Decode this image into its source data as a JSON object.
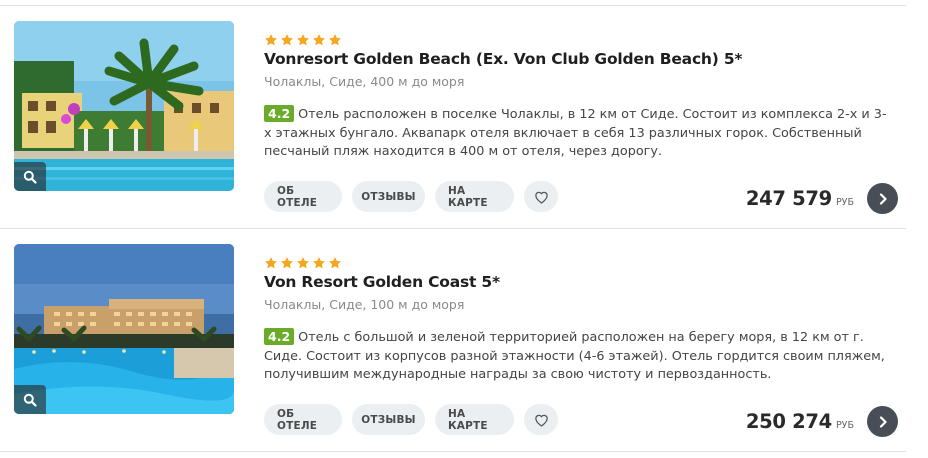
{
  "hotels": [
    {
      "stars": 5,
      "name": "Vonresort Golden Beach (Ex. Von Club Golden Beach) 5*",
      "location": "Чолаклы, Сиде, 400 м до моря",
      "rating": "4.2",
      "description": "Отель расположен в поселке Чолаклы, в 12 км от Сиде. Состоит из комплекса 2-х и 3-х этажных бунгало. Аквапарк отеля включает в себя 13 различных горок. Собственный песчаный пляж находится в 400 м от отеля, через дорогу.",
      "buttons": {
        "about": "ОБ ОТЕЛЕ",
        "reviews": "ОТЗЫВЫ",
        "map": "НА КАРТЕ"
      },
      "price": "247 579",
      "currency": "РУБ"
    },
    {
      "stars": 5,
      "name": "Von Resort Golden Coast 5*",
      "location": "Чолаклы, Сиде, 100 м до моря",
      "rating": "4.2",
      "description": "Отель с большой и зеленой территорией расположен на берегу моря, в 12 км от г. Сиде. Состоит из корпусов разной этажности (4-6 этажей). Отель гордится своим пляжем, получившим международные награды за свою чистоту и первозданность.",
      "buttons": {
        "about": "ОБ ОТЕЛЕ",
        "reviews": "ОТЗЫВЫ",
        "map": "НА КАРТЕ"
      },
      "price": "250 274",
      "currency": "РУБ"
    }
  ],
  "icons": {
    "zoom": "search-icon",
    "favorite": "heart-icon",
    "go": "chevron-right-icon",
    "star": "star-icon"
  },
  "colors": {
    "star": "#f5a623",
    "rating": "#6aac2a",
    "go_button": "#474e56",
    "pill": "#eceff1"
  }
}
